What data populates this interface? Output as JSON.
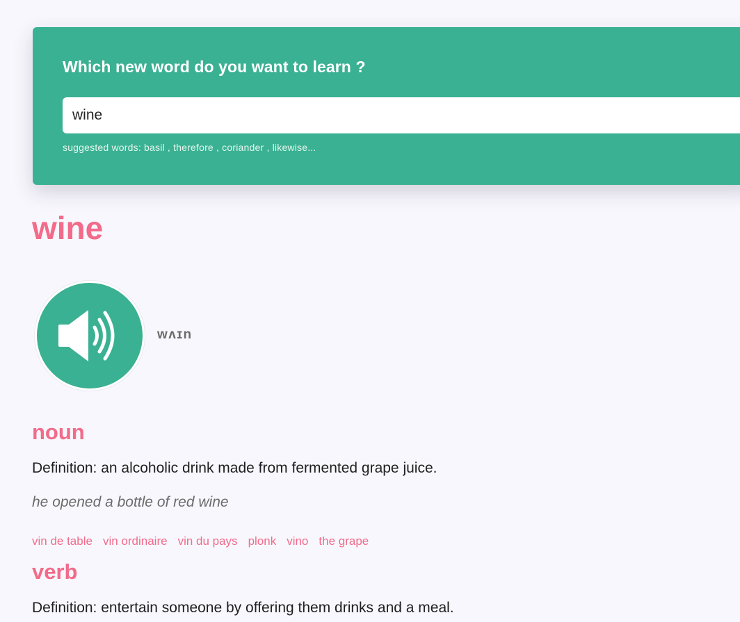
{
  "search": {
    "heading": "Which new word do you want to learn ?",
    "value": "wine",
    "suggested": "suggested words: basil , therefore , coriander , likewise..."
  },
  "entry": {
    "word": "wine",
    "phonetic": "wʌɪn",
    "audio_icon": "speaker-icon",
    "meanings": [
      {
        "part_of_speech": "noun",
        "definition": "Definition: an alcoholic drink made from fermented grape juice.",
        "example": "he opened a bottle of red wine",
        "synonyms": [
          "vin de table",
          "vin ordinaire",
          "vin du pays",
          "plonk",
          "vino",
          "the grape"
        ]
      },
      {
        "part_of_speech": "verb",
        "definition": "Definition: entertain someone by offering them drinks and a meal."
      }
    ]
  },
  "colors": {
    "accent_green": "#3ab192",
    "accent_pink": "#f26b8a",
    "background": "#f8f7fd"
  }
}
